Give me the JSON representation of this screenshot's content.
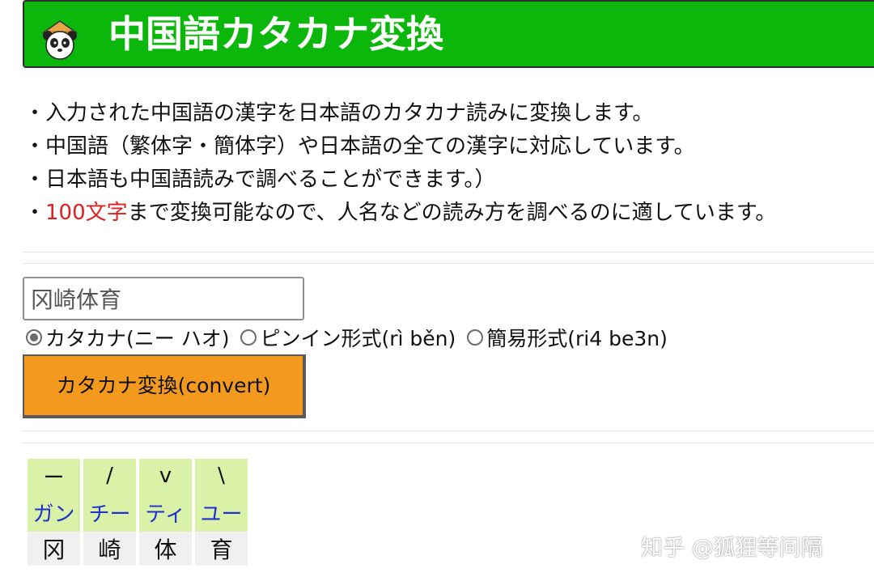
{
  "header": {
    "title": "中国語カタカナ変換",
    "color": "#0bb70b"
  },
  "intro": {
    "line1": "・入力された中国語の漢字を日本語のカタカナ読みに変換します。",
    "line2": "・中国語（繁体字・簡体字）や日本語の全ての漢字に対応しています。",
    "line3": "・日本語も中国語読みで調べることができます。）",
    "line4_prefix": "・",
    "line4_highlight": "100文字",
    "line4_rest": "まで変換可能なので、人名などの読み方を調べるのに適しています。"
  },
  "form": {
    "input_value": "冈崎体育",
    "options": [
      {
        "label": "カタカナ(ニー ハオ)",
        "checked": true
      },
      {
        "label": "ピンイン形式(rì běn)",
        "checked": false
      },
      {
        "label": "簡易形式(ri4 be3n)",
        "checked": false
      }
    ],
    "convert_label": "カタカナ変換(convert)",
    "button_color": "#f39a1e"
  },
  "result": {
    "tones": [
      "ー",
      "/",
      "v",
      "\\"
    ],
    "kana": [
      "ガン",
      "チー",
      "ティ",
      "ユー"
    ],
    "kanji": [
      "冈",
      "崎",
      "体",
      "育"
    ]
  },
  "watermark": "知乎 @狐狸等间隔"
}
